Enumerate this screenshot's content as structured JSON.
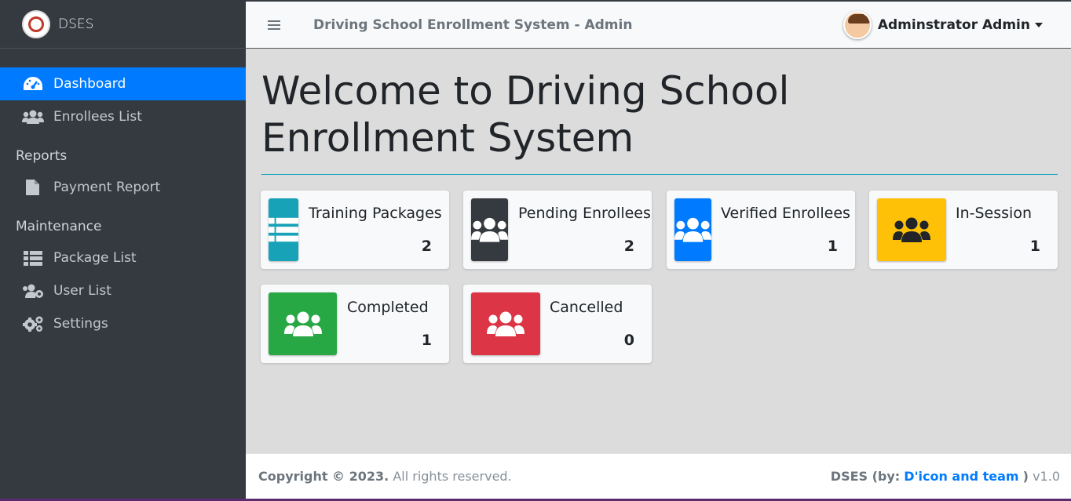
{
  "brand": {
    "name": "DSES"
  },
  "sidebar": {
    "items": [
      {
        "label": "Dashboard",
        "icon": "dashboard-icon",
        "active": true
      },
      {
        "label": "Enrollees List",
        "icon": "users-icon"
      }
    ],
    "reports_header": "Reports",
    "report_items": [
      {
        "label": "Payment Report",
        "icon": "file-icon"
      }
    ],
    "maintenance_header": "Maintenance",
    "maintenance_items": [
      {
        "label": "Package List",
        "icon": "table-icon"
      },
      {
        "label": "User List",
        "icon": "users-cog-icon"
      },
      {
        "label": "Settings",
        "icon": "gears-icon"
      }
    ]
  },
  "header": {
    "title": "Driving School Enrollment System - Admin",
    "user_name": "Adminstrator Admin"
  },
  "main": {
    "welcome": "Welcome to Driving School Enrollment System",
    "cards": [
      {
        "label": "Training Packages",
        "value": "2",
        "color": "#17a2b8",
        "icon": "table-icon"
      },
      {
        "label": "Pending Enrollees",
        "value": "2",
        "color": "#343a40",
        "icon": "users-icon"
      },
      {
        "label": "Verified Enrollees",
        "value": "1",
        "color": "#007bff",
        "icon": "users-icon"
      },
      {
        "label": "In-Session",
        "value": "1",
        "color": "#ffc107",
        "icon": "users-icon"
      },
      {
        "label": "Completed",
        "value": "1",
        "color": "#28a745",
        "icon": "users-icon"
      },
      {
        "label": "Cancelled",
        "value": "0",
        "color": "#dc3545",
        "icon": "users-icon"
      }
    ]
  },
  "footer": {
    "copyright": "Copyright © 2023.",
    "rights": "All rights reserved.",
    "credit_prefix": "DSES (by:",
    "credit_link": "D'icon and team",
    "credit_suffix": ")",
    "version": "v1.0"
  }
}
